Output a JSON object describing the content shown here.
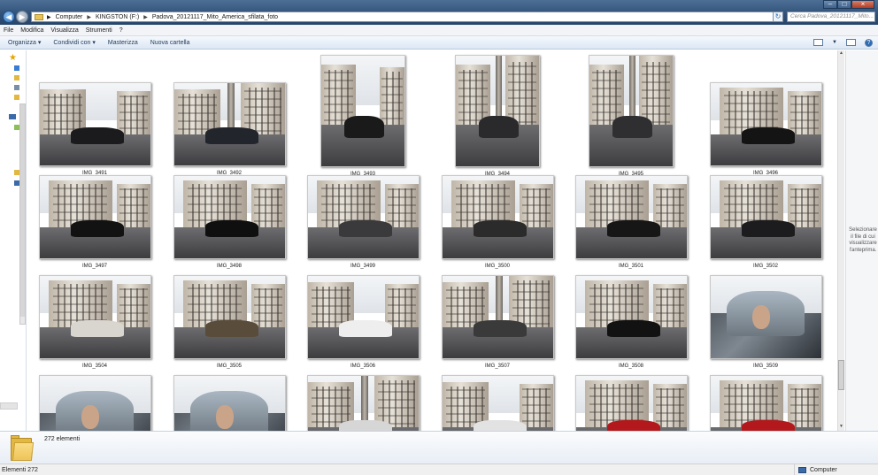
{
  "address": {
    "crumbs": [
      "Computer",
      "KINGSTON (F:)",
      "Padova_20121117_Mito_America_sfilata_foto"
    ],
    "search_placeholder": "Cerca Padova_20121117_Mito..."
  },
  "menu": [
    "File",
    "Modifica",
    "Visualizza",
    "Strumenti",
    "?"
  ],
  "commands": {
    "organize": "Organizza",
    "share": "Condividi con",
    "burn": "Masterizza",
    "new_folder": "Nuova cartella"
  },
  "preview_pane": {
    "message": "Selezionare il file di cui visualizzare l'anteprima."
  },
  "thumbnails": [
    {
      "label": "IMG_3491",
      "orientation": "landscape",
      "scene": "street",
      "car": "#1b1b1d"
    },
    {
      "label": "IMG_3492",
      "orientation": "landscape",
      "scene": "square",
      "car": "#22252b"
    },
    {
      "label": "IMG_3493",
      "orientation": "portrait",
      "scene": "street",
      "car": "#1a1a1a"
    },
    {
      "label": "IMG_3494",
      "orientation": "portrait",
      "scene": "square",
      "car": "#2a2a2c"
    },
    {
      "label": "IMG_3495",
      "orientation": "portrait",
      "scene": "square",
      "car": "#2f2f31"
    },
    {
      "label": "IMG_3496",
      "orientation": "landscape",
      "scene": "building",
      "car": "#141414"
    },
    {
      "label": "IMG_3497",
      "orientation": "landscape",
      "scene": "building",
      "car": "#121212"
    },
    {
      "label": "IMG_3498",
      "orientation": "landscape",
      "scene": "building",
      "car": "#0f0f10"
    },
    {
      "label": "IMG_3499",
      "orientation": "landscape",
      "scene": "building",
      "car": "#3a3a3c"
    },
    {
      "label": "IMG_3500",
      "orientation": "landscape",
      "scene": "building",
      "car": "#2b2b2b"
    },
    {
      "label": "IMG_3501",
      "orientation": "landscape",
      "scene": "building",
      "car": "#161616"
    },
    {
      "label": "IMG_3502",
      "orientation": "landscape",
      "scene": "building",
      "car": "#1c1c1e"
    },
    {
      "label": "IMG_3504",
      "orientation": "landscape",
      "scene": "building",
      "car": "#d9d6cf"
    },
    {
      "label": "IMG_3505",
      "orientation": "landscape",
      "scene": "building",
      "car": "#5a4c3a"
    },
    {
      "label": "IMG_3506",
      "orientation": "landscape",
      "scene": "street",
      "car": "#eeeeee"
    },
    {
      "label": "IMG_3507",
      "orientation": "landscape",
      "scene": "square",
      "car": "#3a3a3a"
    },
    {
      "label": "IMG_3508",
      "orientation": "landscape",
      "scene": "building",
      "car": "#121212"
    },
    {
      "label": "IMG_3509",
      "orientation": "landscape",
      "scene": "interior",
      "car": "#b9c3cc"
    },
    {
      "label": "",
      "orientation": "landscape",
      "scene": "interior",
      "car": "#b9c3cc"
    },
    {
      "label": "",
      "orientation": "landscape",
      "scene": "interior",
      "car": "#b9c3cc"
    },
    {
      "label": "",
      "orientation": "landscape",
      "scene": "square",
      "car": "#d6d6d6"
    },
    {
      "label": "",
      "orientation": "landscape",
      "scene": "street",
      "car": "#e2e2e2"
    },
    {
      "label": "",
      "orientation": "landscape",
      "scene": "building",
      "car": "#b3191c"
    },
    {
      "label": "",
      "orientation": "landscape",
      "scene": "building",
      "car": "#b3191c"
    }
  ],
  "details": {
    "count": "272 elementi"
  },
  "status": {
    "items": "Elementi 272",
    "zone": "Computer"
  }
}
